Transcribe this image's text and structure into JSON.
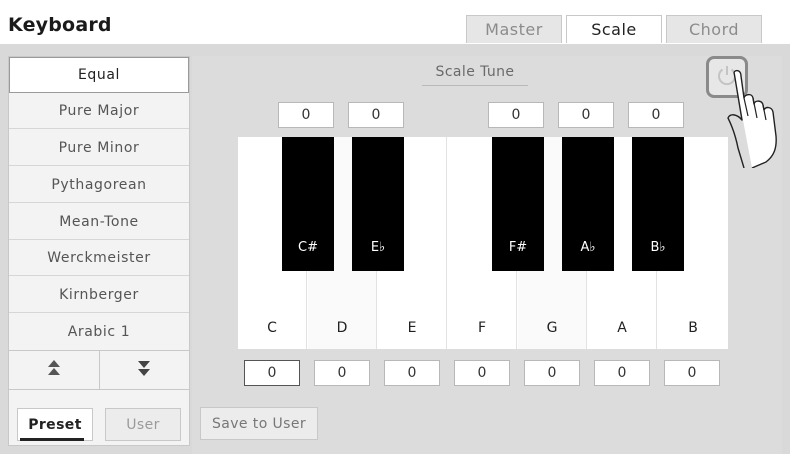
{
  "header": {
    "title": "Keyboard"
  },
  "tabs": [
    {
      "label": "Master",
      "active": false
    },
    {
      "label": "Scale",
      "active": true
    },
    {
      "label": "Chord",
      "active": false
    }
  ],
  "sidebar": {
    "items": [
      {
        "label": "Equal",
        "selected": true
      },
      {
        "label": "Pure Major"
      },
      {
        "label": "Pure Minor"
      },
      {
        "label": "Pythagorean"
      },
      {
        "label": "Mean-Tone"
      },
      {
        "label": "Werckmeister"
      },
      {
        "label": "Kirnberger"
      },
      {
        "label": "Arabic 1"
      }
    ],
    "page_up_icon": "double-triangle-up-icon",
    "page_down_icon": "double-triangle-down-icon",
    "preset_label": "Preset",
    "user_label": "User"
  },
  "main": {
    "scale_tune_label": "Scale Tune",
    "power_icon": "power-icon",
    "save_label": "Save to User"
  },
  "keys": {
    "black": [
      {
        "label": "C#",
        "value": "0"
      },
      {
        "label": "E♭",
        "value": "0"
      },
      {
        "label": "F#",
        "value": "0"
      },
      {
        "label": "A♭",
        "value": "0"
      },
      {
        "label": "B♭",
        "value": "0"
      }
    ],
    "white": [
      {
        "label": "C",
        "value": "0",
        "selected": true
      },
      {
        "label": "D",
        "value": "0"
      },
      {
        "label": "E",
        "value": "0"
      },
      {
        "label": "F",
        "value": "0"
      },
      {
        "label": "G",
        "value": "0"
      },
      {
        "label": "A",
        "value": "0"
      },
      {
        "label": "B",
        "value": "0"
      }
    ]
  },
  "colors": {
    "panel_bg": "#d9d9d9",
    "accent": "#222222",
    "power_border": "#8a8a8a"
  }
}
